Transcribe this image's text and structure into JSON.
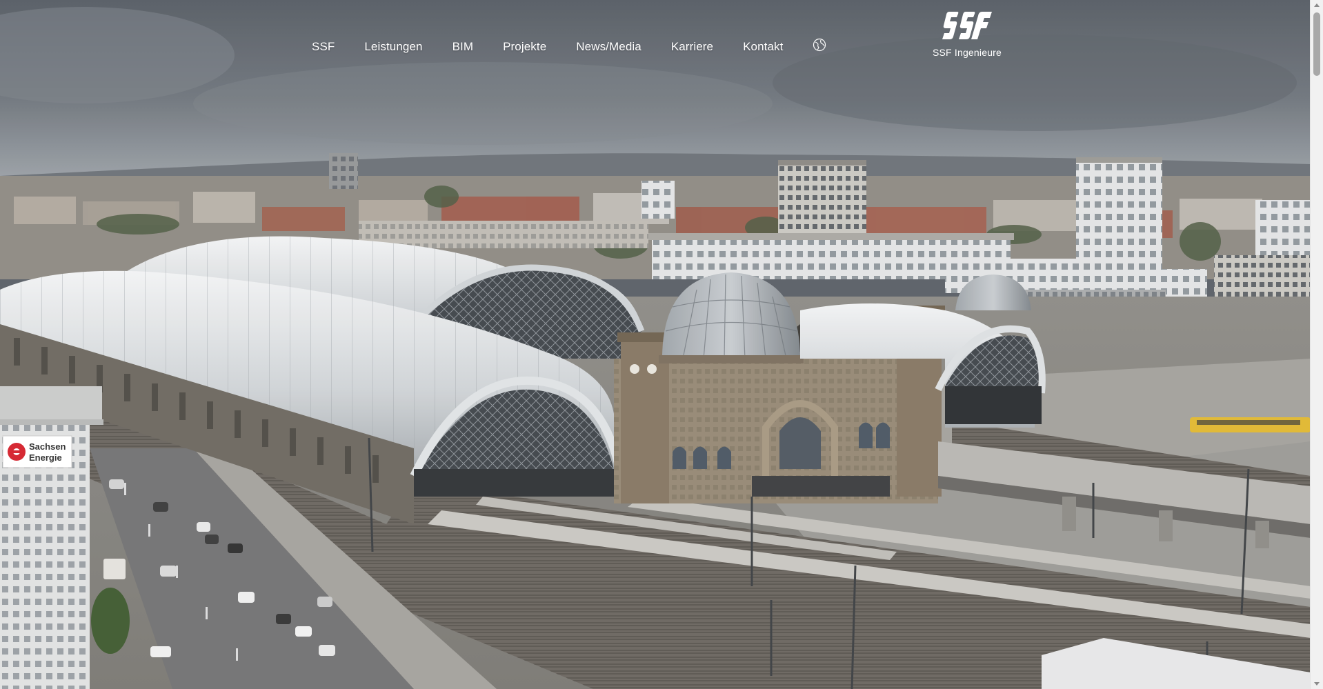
{
  "nav": {
    "items": [
      {
        "label": "SSF"
      },
      {
        "label": "Leistungen"
      },
      {
        "label": "BIM"
      },
      {
        "label": "Projekte"
      },
      {
        "label": "News/Media"
      },
      {
        "label": "Karriere"
      },
      {
        "label": "Kontakt"
      }
    ],
    "language_icon": "globe-icon"
  },
  "logo": {
    "text": "SSF Ingenieure",
    "icon": "ssf-logo-mark"
  },
  "hero": {
    "sign_line1": "Sachsen",
    "sign_line2": "Energie"
  },
  "colors": {
    "nav_text": "#ffffff",
    "sky_top": "#626870",
    "roof": "#d9dcdf",
    "stone": "#8c7d68"
  }
}
